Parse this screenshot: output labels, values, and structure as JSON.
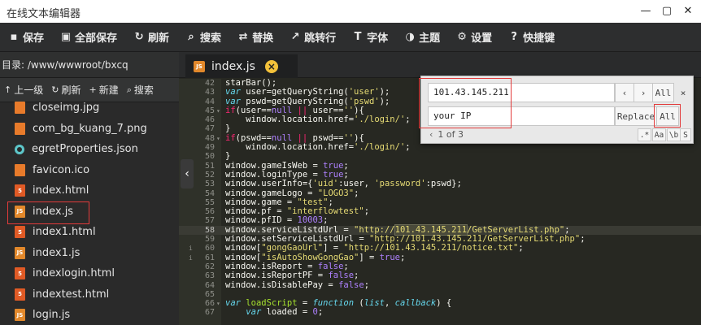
{
  "window": {
    "title": "在线文本编辑器",
    "minimize_icon": "minimize-icon",
    "maximize_icon": "maximize-icon",
    "close_icon": "close-icon"
  },
  "toolbar": [
    {
      "label": "保存",
      "icon": "save-icon",
      "glyph": "▪"
    },
    {
      "label": "全部保存",
      "icon": "save-all-icon",
      "glyph": "▣"
    },
    {
      "label": "刷新",
      "icon": "refresh-icon",
      "glyph": "↻"
    },
    {
      "label": "搜索",
      "icon": "search-icon",
      "glyph": "⌕"
    },
    {
      "label": "替换",
      "icon": "replace-icon",
      "glyph": "⇄"
    },
    {
      "label": "跳转行",
      "icon": "goto-line-icon",
      "glyph": "↗"
    },
    {
      "label": "字体",
      "icon": "font-icon",
      "glyph": "T"
    },
    {
      "label": "主题",
      "icon": "theme-icon",
      "glyph": "◑"
    },
    {
      "label": "设置",
      "icon": "gear-icon",
      "glyph": "⚙"
    },
    {
      "label": "快捷键",
      "icon": "help-icon",
      "glyph": "?"
    }
  ],
  "sidebar": {
    "directory": "目录: /www/wwwroot/bxcq",
    "tools": [
      {
        "label": "上一级",
        "icon": "up-arrow-icon",
        "glyph": "↑"
      },
      {
        "label": "刷新",
        "icon": "refresh-icon",
        "glyph": "↻"
      },
      {
        "label": "新建",
        "icon": "plus-icon",
        "glyph": "+"
      },
      {
        "label": "搜索",
        "icon": "search-icon",
        "glyph": "⌕"
      }
    ],
    "files": [
      {
        "name": "closeimg.jpg",
        "type": "img",
        "icon": "image-file-icon"
      },
      {
        "name": "com_bg_kuang_7.png",
        "type": "img",
        "icon": "image-file-icon"
      },
      {
        "name": "egretProperties.json",
        "type": "json",
        "icon": "json-file-icon"
      },
      {
        "name": "favicon.ico",
        "type": "ico",
        "icon": "image-file-icon"
      },
      {
        "name": "index.html",
        "type": "html",
        "icon": "html-file-icon"
      },
      {
        "name": "index.js",
        "type": "js",
        "icon": "js-file-icon",
        "selected": true
      },
      {
        "name": "index1.html",
        "type": "html",
        "icon": "html-file-icon"
      },
      {
        "name": "index1.js",
        "type": "js",
        "icon": "js-file-icon"
      },
      {
        "name": "indexlogin.html",
        "type": "html",
        "icon": "html-file-icon"
      },
      {
        "name": "indextest.html",
        "type": "html",
        "icon": "html-file-icon"
      },
      {
        "name": "login.js",
        "type": "js",
        "icon": "js-file-icon"
      }
    ]
  },
  "tab": {
    "label": "index.js",
    "icon": "js-file-icon",
    "close_icon": "close-icon",
    "close_glyph": "×"
  },
  "collapse_glyph": "‹",
  "search_panel": {
    "find_value": "101.43.145.211",
    "replace_value": "your IP",
    "prev_glyph": "‹",
    "next_glyph": "›",
    "find_all": "All",
    "close_glyph": "×",
    "replace_label": "Replace",
    "replace_all": "All",
    "match_count": "1 of 3",
    "toggle_glyph": "‹",
    "options": [
      ".*",
      "Aa",
      "\\b",
      "S"
    ]
  },
  "editor": {
    "lines": [
      {
        "n": "42",
        "html": "starBar();"
      },
      {
        "n": "43",
        "html": "<span class='k'>var</span> user=getQueryString(<span class='s'>'user'</span>);"
      },
      {
        "n": "44",
        "html": "<span class='k'>var</span> pswd=getQueryString(<span class='s'>'pswd'</span>);"
      },
      {
        "n": "45",
        "fold": "▾",
        "html": "<span class='kw'>if</span>(user==<span class='n'>null</span> <span class='kw'>||</span> user==<span class='s'>''</span>){"
      },
      {
        "n": "46",
        "html": "    window.location.href=<span class='s'>'./login/'</span>;"
      },
      {
        "n": "47",
        "html": "}"
      },
      {
        "n": "48",
        "fold": "▾",
        "html": "<span class='kw'>if</span>(pswd==<span class='n'>null</span> <span class='kw'>||</span> pswd==<span class='s'>''</span>){"
      },
      {
        "n": "49",
        "html": "    window.location.href=<span class='s'>'./login/'</span>;"
      },
      {
        "n": "50",
        "html": "}"
      },
      {
        "n": "51",
        "html": "window.gameIsWeb = <span class='n'>true</span>;"
      },
      {
        "n": "52",
        "html": "window.loginType = <span class='n'>true</span>;"
      },
      {
        "n": "53",
        "html": "window.userInfo={<span class='s'>'uid'</span>:user, <span class='s'>'password'</span>:pswd};"
      },
      {
        "n": "54",
        "html": "window.gameLogo = <span class='s'>\"LOGO3\"</span>;"
      },
      {
        "n": "55",
        "html": "window.game = <span class='s'>\"test\"</span>;"
      },
      {
        "n": "56",
        "html": "window.pf = <span class='s'>\"interflowtest\"</span>;"
      },
      {
        "n": "57",
        "html": "window.pfID = <span class='n'>10003</span>;"
      },
      {
        "n": "58",
        "active": true,
        "html": "window.serviceListdUrl = <span class='s'>\"http://<span class='mark'>101.43.145.211</span>/GetServerList.php\"</span>;"
      },
      {
        "n": "59",
        "html": "window.setServiceListdUrl = <span class='s'>\"http://101.43.145.211/GetServerList.php\"</span>;"
      },
      {
        "n": "60",
        "mark": "i",
        "html": "window[<span class='s'>\"gongGaoUrl\"</span>] = <span class='s'>\"http://101.43.145.211/notice.txt\"</span>;"
      },
      {
        "n": "61",
        "mark": "i",
        "html": "window[<span class='s'>\"isAutoShowGongGao\"</span>] = <span class='n'>true</span>;"
      },
      {
        "n": "62",
        "html": "window.isReport = <span class='n'>false</span>;"
      },
      {
        "n": "63",
        "html": "window.isReportPF = <span class='n'>false</span>;"
      },
      {
        "n": "64",
        "html": "window.isDisablePay = <span class='n'>false</span>;"
      },
      {
        "n": "65",
        "html": ""
      },
      {
        "n": "66",
        "fold": "▾",
        "html": "<span class='k'>var</span> <span class='fn'>loadScript</span> = <span class='k'>function</span> (<span class='k'>list</span>, <span class='k'>callback</span>) {"
      },
      {
        "n": "67",
        "html": "    <span class='k'>var</span> loaded = <span class='n'>0</span>;"
      }
    ]
  }
}
